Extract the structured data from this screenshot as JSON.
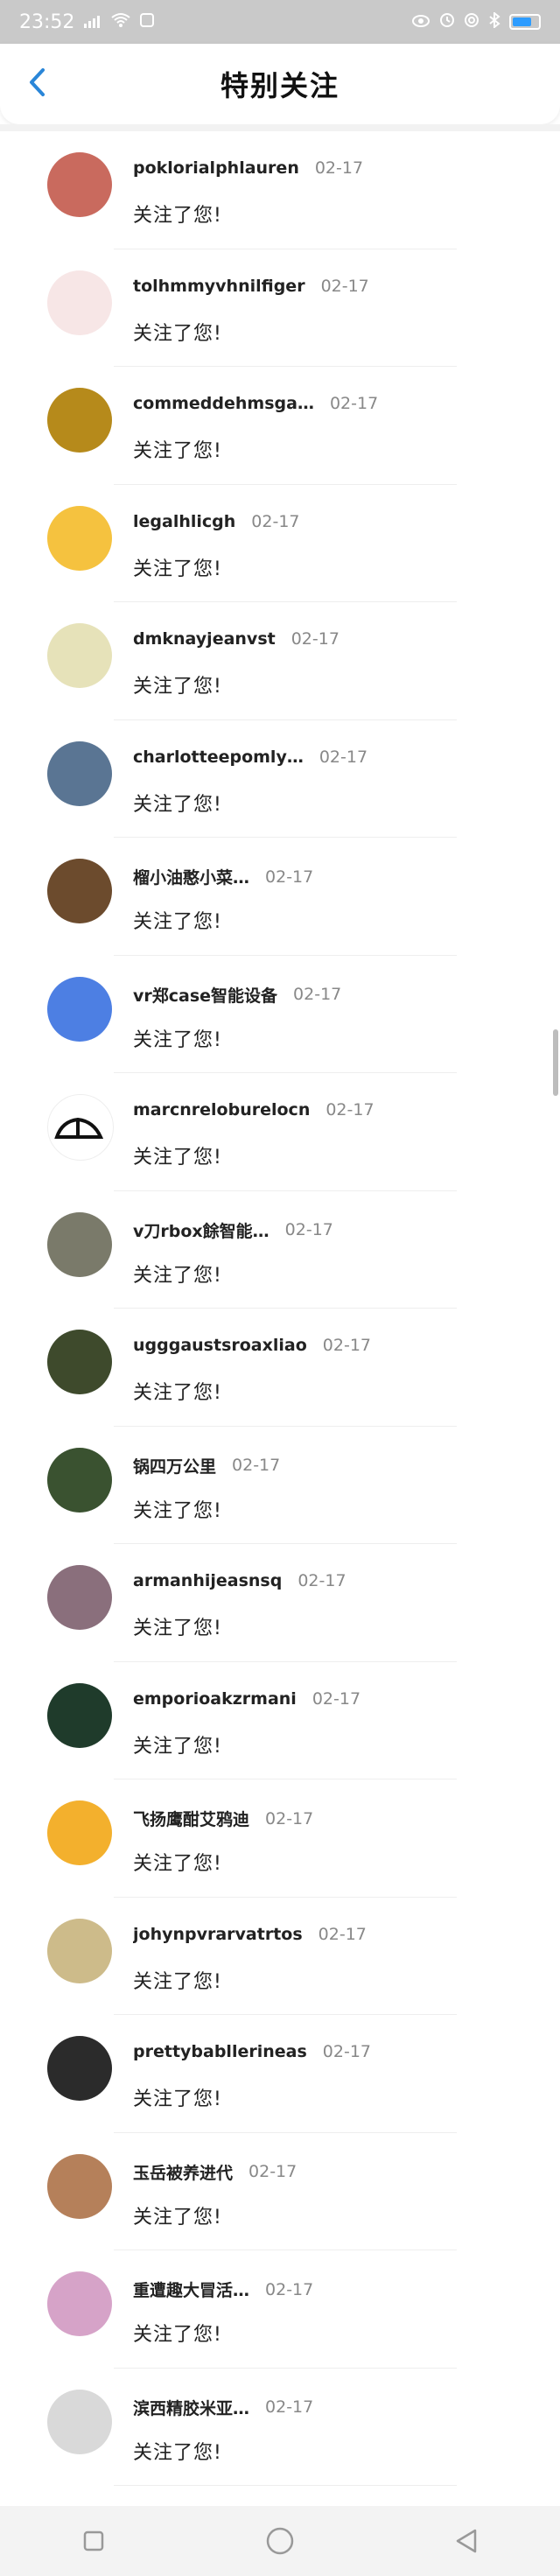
{
  "status_bar": {
    "time": "23:52",
    "signal_label": "4G",
    "battery_level": 0.7
  },
  "header": {
    "title": "特别关注"
  },
  "list": {
    "items": [
      {
        "name": "poklorialphlauren",
        "date": "02-17",
        "message": "关注了您!",
        "avatar_color": "#c96a5e"
      },
      {
        "name": "tolhmmyvhnilfiger",
        "date": "02-17",
        "message": "关注了您!",
        "avatar_color": "#f7e6e6"
      },
      {
        "name": "commeddehmsga…",
        "date": "02-17",
        "message": "关注了您!",
        "avatar_color": "#b68a1b"
      },
      {
        "name": "legalhlicgh",
        "date": "02-17",
        "message": "关注了您!",
        "avatar_color": "#f5c23f"
      },
      {
        "name": "dmknayjeanvst",
        "date": "02-17",
        "message": "关注了您!",
        "avatar_color": "#e6e2b9"
      },
      {
        "name": "charlotteepomly…",
        "date": "02-17",
        "message": "关注了您!",
        "avatar_color": "#5a7593"
      },
      {
        "name": "榴小油憨小菜…",
        "date": "02-17",
        "message": "关注了您!",
        "avatar_color": "#6c4b2d"
      },
      {
        "name": "vr郑case智能设备",
        "date": "02-17",
        "message": "关注了您!",
        "avatar_color": "#4d7fe3"
      },
      {
        "name": "marcnreloburelocn",
        "date": "02-17",
        "message": "关注了您!",
        "avatar_color": "#ffffff"
      },
      {
        "name": "v刀rbox餘智能…",
        "date": "02-17",
        "message": "关注了您!",
        "avatar_color": "#7a7a6a"
      },
      {
        "name": "ugggaustsroaxliao",
        "date": "02-17",
        "message": "关注了您!",
        "avatar_color": "#3e4a2c"
      },
      {
        "name": "锅四万公里",
        "date": "02-17",
        "message": "关注了您!",
        "avatar_color": "#3a5230"
      },
      {
        "name": "armanhijeasnsq",
        "date": "02-17",
        "message": "关注了您!",
        "avatar_color": "#8a6f7c"
      },
      {
        "name": "emporioakzrmani",
        "date": "02-17",
        "message": "关注了您!",
        "avatar_color": "#1f3b2b"
      },
      {
        "name": "飞扬鹰酣艾鸦迪",
        "date": "02-17",
        "message": "关注了您!",
        "avatar_color": "#f3b02d"
      },
      {
        "name": "johynpvrarvatrtos",
        "date": "02-17",
        "message": "关注了您!",
        "avatar_color": "#cdbb8a"
      },
      {
        "name": "prettybabllerineas",
        "date": "02-17",
        "message": "关注了您!",
        "avatar_color": "#2b2b2b"
      },
      {
        "name": "玉岳被养进代",
        "date": "02-17",
        "message": "关注了您!",
        "avatar_color": "#b5805a"
      },
      {
        "name": "重遭趣大冒活…",
        "date": "02-17",
        "message": "关注了您!",
        "avatar_color": "#d6a3c8"
      },
      {
        "name": "滨西精胶米亚…",
        "date": "02-17",
        "message": "关注了您!",
        "avatar_color": "#d9d9d9"
      }
    ]
  },
  "scrollbar": {
    "thumb_position_fraction": 0.38,
    "thumb_length_fraction": 0.028
  }
}
